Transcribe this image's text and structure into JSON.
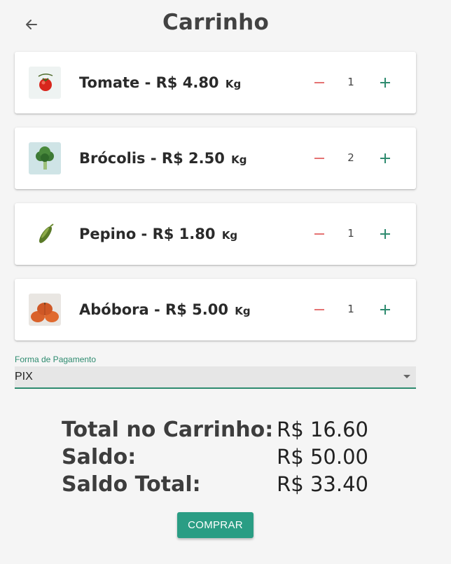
{
  "header": {
    "title": "Carrinho",
    "back_icon": "arrow-left-icon"
  },
  "cart": {
    "items": [
      {
        "name": "Tomate",
        "price": "R$ 4.80",
        "unit": "Kg",
        "quantity": "1",
        "image": "tomato"
      },
      {
        "name": "Brócolis",
        "price": "R$ 2.50",
        "unit": "Kg",
        "quantity": "2",
        "image": "broccoli"
      },
      {
        "name": "Pepino",
        "price": "R$ 1.80",
        "unit": "Kg",
        "quantity": "1",
        "image": "cucumber"
      },
      {
        "name": "Abóbora",
        "price": "R$ 5.00",
        "unit": "Kg",
        "quantity": "1",
        "image": "pumpkin"
      }
    ]
  },
  "payment": {
    "label": "Forma de Pagamento",
    "selected": "PIX"
  },
  "summary": {
    "cart_total_label": "Total no Carrinho:",
    "cart_total_value": "R$ 16.60",
    "balance_label": "Saldo:",
    "balance_value": "R$ 50.00",
    "final_balance_label": "Saldo Total:",
    "final_balance_value": "R$ 33.40"
  },
  "actions": {
    "buy_label": "COMPRAR"
  },
  "colors": {
    "accent": "#2a9d84",
    "minus": "#e57373",
    "plus": "#2e8b6f",
    "background": "#f5f5f5"
  }
}
